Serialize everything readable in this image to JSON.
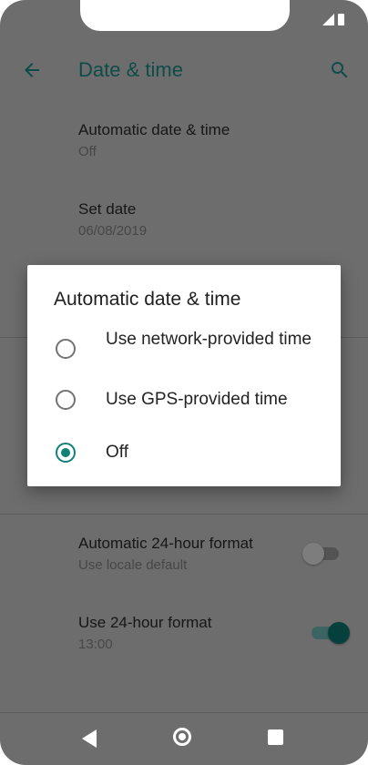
{
  "status_bar": {
    "signal_icon": "signal-icon",
    "battery_icon": "battery-icon"
  },
  "app_bar": {
    "back_icon": "arrow-back-icon",
    "title": "Date & time",
    "search_icon": "search-icon"
  },
  "settings": [
    {
      "title": "Automatic date & time",
      "summary": "Off"
    },
    {
      "title": "Set date",
      "summary": "06/08/2019"
    },
    {
      "title": "Automatic 24-hour format",
      "summary": "Use locale default",
      "toggle": "off"
    },
    {
      "title": "Use 24-hour format",
      "summary": "13:00",
      "toggle": "on"
    }
  ],
  "dialog": {
    "title": "Automatic date & time",
    "options": [
      {
        "label": "Use network-provided time",
        "selected": false
      },
      {
        "label": "Use GPS-provided time",
        "selected": false
      },
      {
        "label": "Off",
        "selected": true
      }
    ]
  },
  "nav_bar": {
    "back_icon": "nav-back-icon",
    "home_icon": "nav-home-icon",
    "recents_icon": "nav-recents-icon"
  },
  "colors": {
    "accent": "#0e8276",
    "scrim_background": "#6d6d6d",
    "title_color": "#0e4c49"
  }
}
